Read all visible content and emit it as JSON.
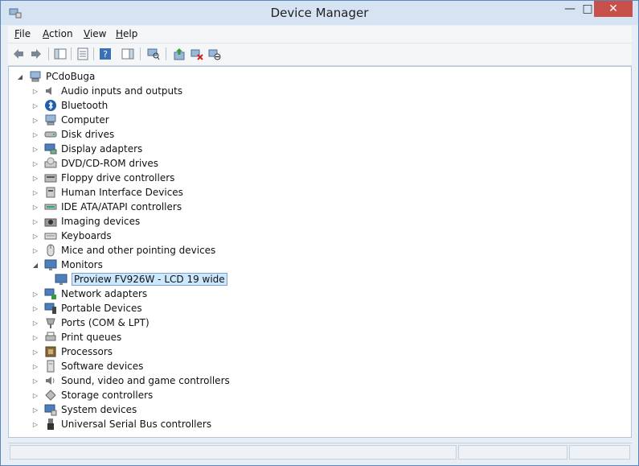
{
  "window": {
    "title": "Device Manager"
  },
  "menu": [
    {
      "first": "F",
      "rest": "ile"
    },
    {
      "first": "A",
      "rest": "ction"
    },
    {
      "first": "V",
      "rest": "iew"
    },
    {
      "first": "H",
      "rest": "elp"
    }
  ],
  "toolbar": {
    "icons": [
      "back-icon",
      "forward-icon",
      "show-hide-console-tree-icon",
      "properties-icon",
      "help-icon",
      "show-action-pane-icon",
      "scan-hardware-icon",
      "update-driver-icon",
      "uninstall-icon",
      "disable-icon"
    ]
  },
  "tree": {
    "root": "PCdoBuga",
    "categories": [
      {
        "label": "Audio inputs and outputs",
        "icon": "speaker-icon",
        "expanded": false
      },
      {
        "label": "Bluetooth",
        "icon": "bluetooth-icon",
        "expanded": false
      },
      {
        "label": "Computer",
        "icon": "computer-icon",
        "expanded": false
      },
      {
        "label": "Disk drives",
        "icon": "disk-drive-icon",
        "expanded": false
      },
      {
        "label": "Display adapters",
        "icon": "display-adapter-icon",
        "expanded": false
      },
      {
        "label": "DVD/CD-ROM drives",
        "icon": "dvd-drive-icon",
        "expanded": false
      },
      {
        "label": "Floppy drive controllers",
        "icon": "floppy-controller-icon",
        "expanded": false
      },
      {
        "label": "Human Interface Devices",
        "icon": "hid-icon",
        "expanded": false
      },
      {
        "label": "IDE ATA/ATAPI controllers",
        "icon": "ide-controller-icon",
        "expanded": false
      },
      {
        "label": "Imaging devices",
        "icon": "camera-icon",
        "expanded": false
      },
      {
        "label": "Keyboards",
        "icon": "keyboard-icon",
        "expanded": false
      },
      {
        "label": "Mice and other pointing devices",
        "icon": "mouse-icon",
        "expanded": false
      },
      {
        "label": "Monitors",
        "icon": "monitor-icon",
        "expanded": true
      },
      {
        "label": "Network adapters",
        "icon": "network-adapter-icon",
        "expanded": false
      },
      {
        "label": "Portable Devices",
        "icon": "portable-device-icon",
        "expanded": false
      },
      {
        "label": "Ports (COM & LPT)",
        "icon": "port-icon",
        "expanded": false
      },
      {
        "label": "Print queues",
        "icon": "printer-icon",
        "expanded": false
      },
      {
        "label": "Processors",
        "icon": "processor-icon",
        "expanded": false
      },
      {
        "label": "Software devices",
        "icon": "software-device-icon",
        "expanded": false
      },
      {
        "label": "Sound, video and game controllers",
        "icon": "sound-icon",
        "expanded": false
      },
      {
        "label": "Storage controllers",
        "icon": "storage-controller-icon",
        "expanded": false
      },
      {
        "label": "System devices",
        "icon": "system-device-icon",
        "expanded": false
      },
      {
        "label": "Universal Serial Bus controllers",
        "icon": "usb-icon",
        "expanded": false
      }
    ],
    "monitor_child": "Proview FV926W - LCD 19 wide"
  },
  "colors": {
    "selection": "#cce8ff",
    "close_button": "#c7504a"
  }
}
